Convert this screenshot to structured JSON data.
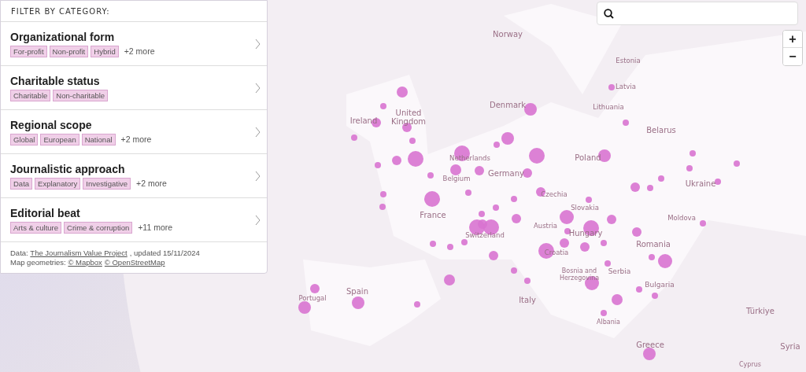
{
  "filter_panel": {
    "heading": "FILTER BY CATEGORY:",
    "categories": [
      {
        "title": "Organizational form",
        "tags": [
          "For-profit",
          "Non-profit",
          "Hybrid"
        ],
        "more": "+2 more"
      },
      {
        "title": "Charitable status",
        "tags": [
          "Charitable",
          "Non-charitable"
        ]
      },
      {
        "title": "Regional scope",
        "tags": [
          "Global",
          "European",
          "National"
        ],
        "more": "+2 more"
      },
      {
        "title": "Journalistic approach",
        "tags": [
          "Data",
          "Explanatory",
          "Investigative"
        ],
        "more": "+2 more"
      },
      {
        "title": "Editorial beat",
        "tags": [
          "Arts & culture",
          "Crime & corruption"
        ],
        "more": "+11 more"
      }
    ],
    "credits": [
      {
        "prefix": "Data: ",
        "links": [
          "The Journalism Value Project"
        ],
        "suffix": ", updated 15/11/2024"
      },
      {
        "prefix": "Map geometries: ",
        "links": [
          "© Mapbox",
          "© OpenStreetMap"
        ]
      }
    ]
  },
  "map": {
    "labels": [
      "Norway",
      "Estonia",
      "Latvia",
      "Lithuania",
      "Belarus",
      "Ireland",
      "United Kingdom",
      "Denmark",
      "Netherlands",
      "Belgium",
      "Germany",
      "Poland",
      "Ukraine",
      "France",
      "Czechia",
      "Slovakia",
      "Moldova",
      "Austria",
      "Hungary",
      "Switzerland",
      "Romania",
      "Croatia",
      "Bosnia and Herzegovina",
      "Serbia",
      "Bulgaria",
      "Spain",
      "Portugal",
      "Italy",
      "Albania",
      "Türkiye",
      "Greece",
      "Cyprus",
      "Syria"
    ]
  },
  "zoom_controls": [
    "+",
    "−"
  ]
}
